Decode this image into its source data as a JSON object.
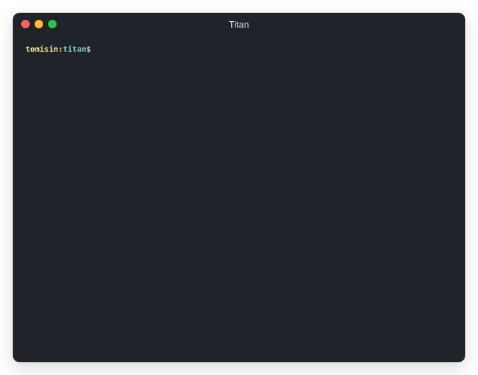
{
  "window": {
    "title": "Titan"
  },
  "traffic_lights": {
    "close_color": "#ff5f57",
    "minimize_color": "#febc2e",
    "zoom_color": "#28c840"
  },
  "prompt": {
    "user": "tomisin",
    "separator": ":",
    "host": "titan",
    "symbol": "$",
    "command": ""
  }
}
